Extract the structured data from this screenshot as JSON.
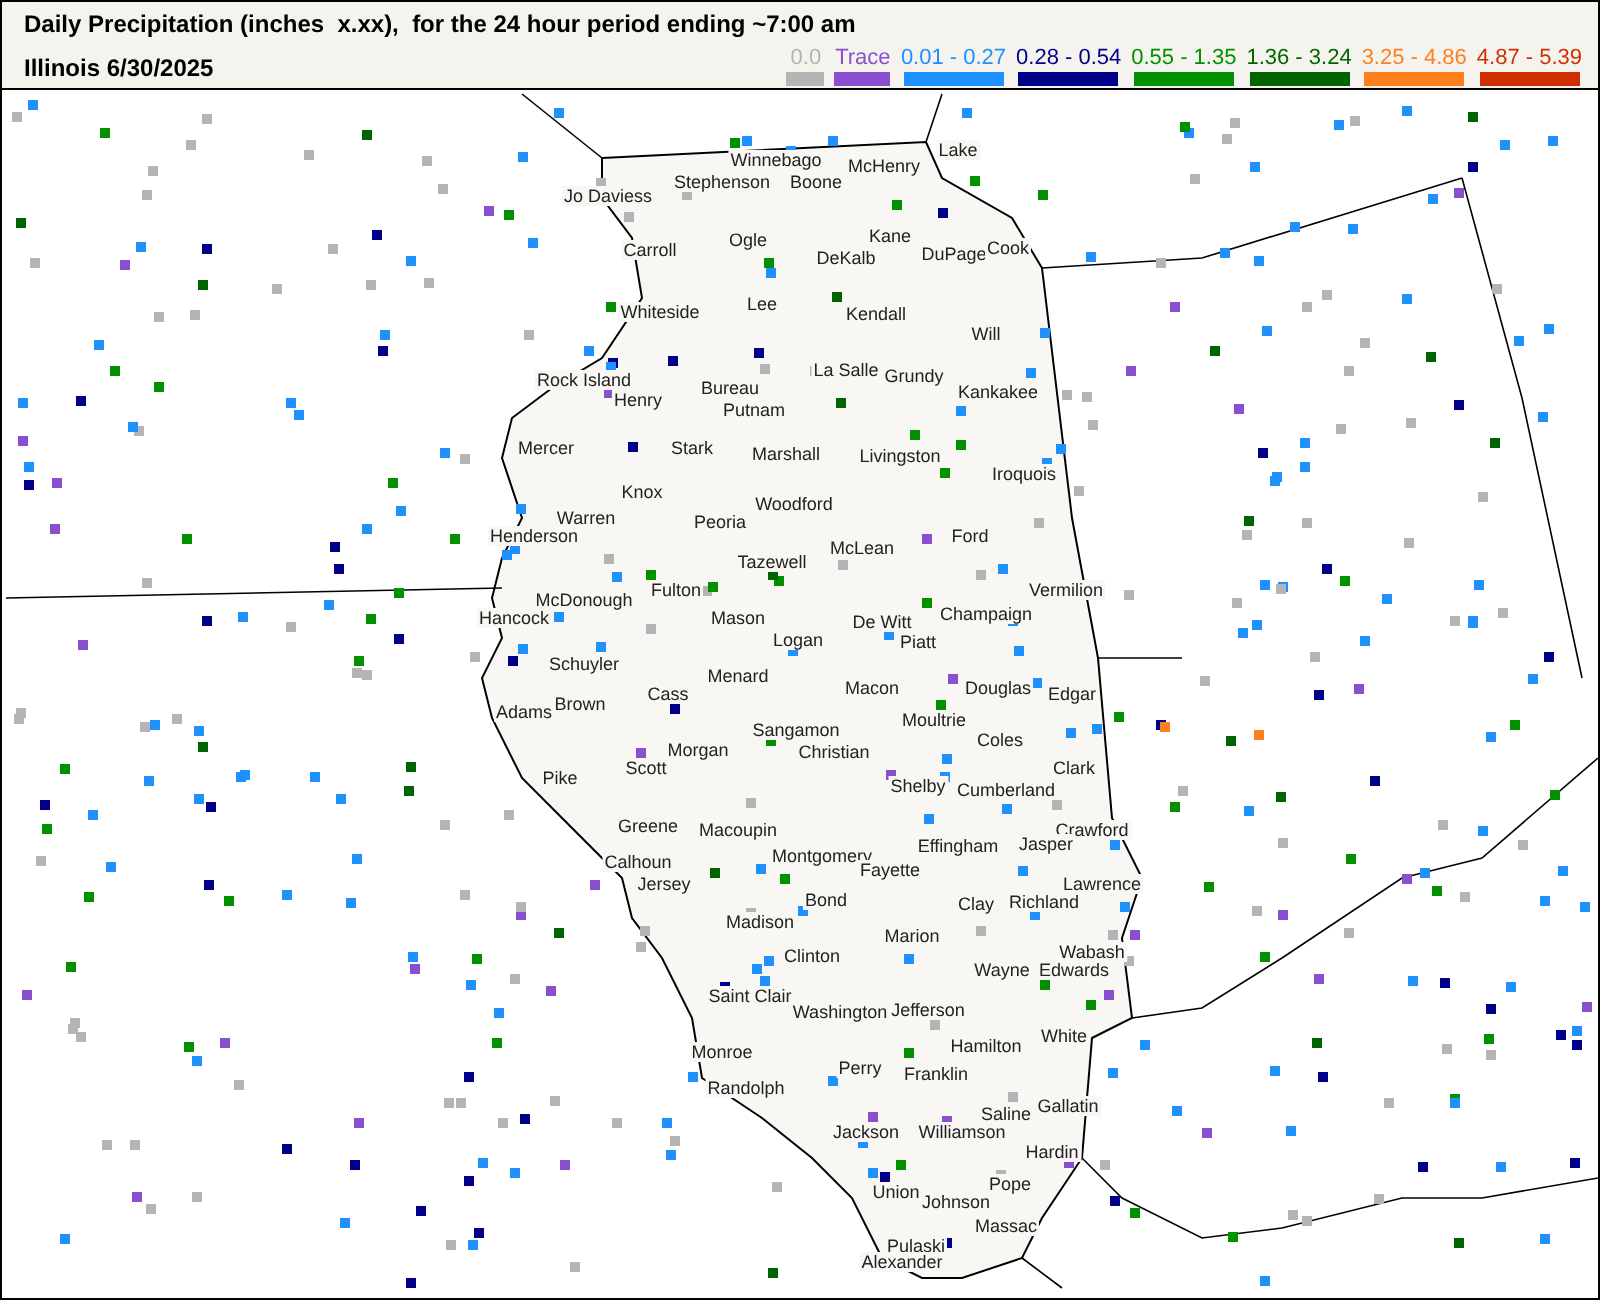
{
  "title": "Daily Precipitation (inches  x.xx),  for the 24 hour period ending ~7:00 am",
  "subtitle": "Illinois 6/30/2025",
  "legend": [
    {
      "label": "0.0",
      "color": "#b4b4b4"
    },
    {
      "label": "Trace",
      "color": "#8a4fd0"
    },
    {
      "label": "0.01 - 0.27",
      "color": "#1e90ff"
    },
    {
      "label": "0.28 - 0.54",
      "color": "#00008b"
    },
    {
      "label": "0.55 - 1.35",
      "color": "#009000"
    },
    {
      "label": "1.36 - 3.24",
      "color": "#006400"
    },
    {
      "label": "3.25 - 4.86",
      "color": "#ff7f1f"
    },
    {
      "label": "4.87 - 5.39",
      "color": "#d03000"
    }
  ],
  "map": {
    "counties": [
      "Jo Daviess",
      "Stephenson",
      "Winnebago",
      "Boone",
      "McHenry",
      "Lake",
      "Carroll",
      "Ogle",
      "DeKalb",
      "Kane",
      "DuPage",
      "Cook",
      "Whiteside",
      "Lee",
      "Kendall",
      "Will",
      "Rock Island",
      "Henry",
      "Bureau",
      "Putnam",
      "La Salle",
      "Grundy",
      "Kankakee",
      "Mercer",
      "Stark",
      "Marshall",
      "Livingston",
      "Iroquois",
      "Knox",
      "Warren",
      "Peoria",
      "Woodford",
      "Henderson",
      "Tazewell",
      "McLean",
      "Ford",
      "Vermilion",
      "Fulton",
      "Hancock",
      "McDonough",
      "Mason",
      "De Witt",
      "Champaign",
      "Logan",
      "Piatt",
      "Schuyler",
      "Cass",
      "Menard",
      "Macon",
      "Douglas",
      "Edgar",
      "Adams",
      "Brown",
      "Sangamon",
      "Moultrie",
      "Coles",
      "Morgan",
      "Scott",
      "Christian",
      "Clark",
      "Pike",
      "Shelby",
      "Cumberland",
      "Greene",
      "Macoupin",
      "Crawford",
      "Calhoun",
      "Montgomery",
      "Effingham",
      "Jasper",
      "Fayette",
      "Jersey",
      "Lawrence",
      "Bond",
      "Clay",
      "Richland",
      "Madison",
      "Marion",
      "Wabash",
      "Clinton",
      "Wayne",
      "Edwards",
      "Saint Clair",
      "Washington",
      "Jefferson",
      "White",
      "Hamilton",
      "Monroe",
      "Perry",
      "Franklin",
      "Randolph",
      "Gallatin",
      "Saline",
      "Jackson",
      "Williamson",
      "Hardin",
      "Union",
      "Pope",
      "Johnson",
      "Massac",
      "Pulaski",
      "Alexander"
    ]
  }
}
